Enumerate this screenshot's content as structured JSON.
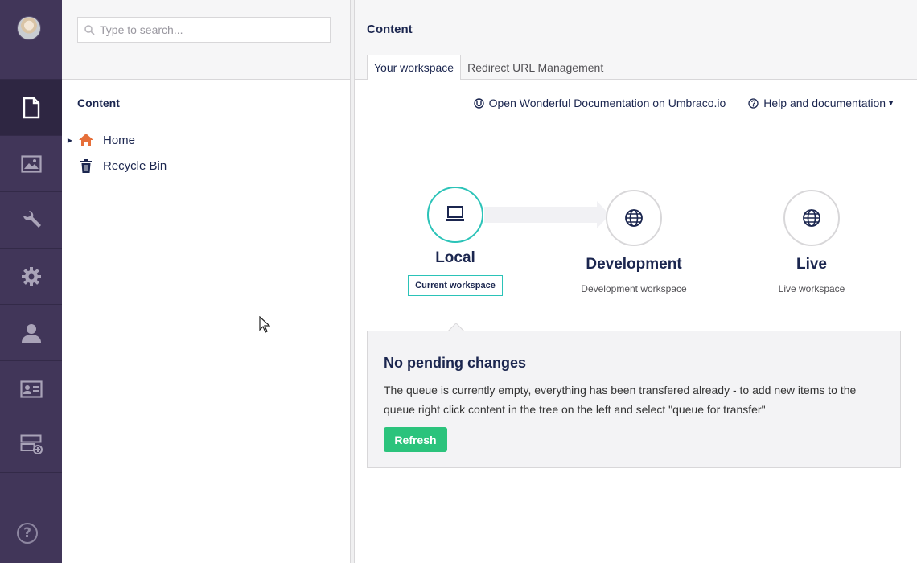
{
  "search": {
    "placeholder": "Type to search..."
  },
  "tree": {
    "title": "Content",
    "nodes": [
      {
        "label": "Home",
        "icon": "home-icon",
        "icon_color": "#e66f3a"
      },
      {
        "label": "Recycle Bin",
        "icon": "trash-icon"
      }
    ]
  },
  "sections": [
    {
      "name": "content",
      "icon": "document-icon",
      "active": true
    },
    {
      "name": "media",
      "icon": "image-icon"
    },
    {
      "name": "settings",
      "icon": "wrench-icon"
    },
    {
      "name": "developer",
      "icon": "gear-icon"
    },
    {
      "name": "users",
      "icon": "user-icon"
    },
    {
      "name": "members",
      "icon": "id-card-icon"
    },
    {
      "name": "deploy",
      "icon": "server-add-icon"
    }
  ],
  "help_icon": "?",
  "main": {
    "title": "Content",
    "tabs": [
      {
        "label": "Your workspace",
        "active": true
      },
      {
        "label": "Redirect URL Management"
      }
    ],
    "links": [
      {
        "label": "Open Wonderful Documentation on Umbraco.io",
        "icon": "umbraco-icon"
      },
      {
        "label": "Help and documentation",
        "icon": "question-circle-icon"
      }
    ]
  },
  "workspaces": [
    {
      "name": "Local",
      "badge": "Current workspace",
      "icon": "laptop-icon",
      "current": true
    },
    {
      "name": "Development",
      "desc": "Development workspace",
      "icon": "globe-icon"
    },
    {
      "name": "Live",
      "desc": "Live workspace",
      "icon": "globe-icon"
    }
  ],
  "pending": {
    "title": "No pending changes",
    "text": "The queue is currently empty, everything has been transfered already - to add new items to the queue right click content in the tree on the left and select \"queue for transfer\"",
    "refresh_label": "Refresh"
  },
  "colors": {
    "rail": "#413659",
    "accent": "#2bc3b8",
    "refresh": "#2bc37c",
    "home": "#e66f3a"
  }
}
